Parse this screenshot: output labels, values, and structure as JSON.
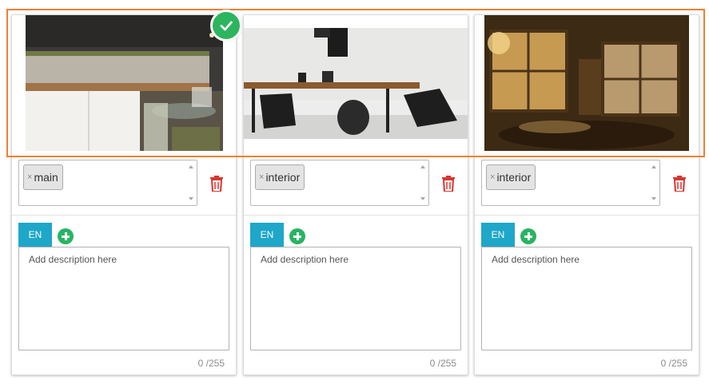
{
  "colors": {
    "selection_border": "#f07f32",
    "selected_badge": "#2cb55e",
    "lang_tab": "#1ea7c9",
    "add_button": "#27b563",
    "delete_icon": "#d9362f"
  },
  "cards": [
    {
      "image": "kitchen-photo",
      "selected": true,
      "tags": [
        "main"
      ],
      "language_tab": "EN",
      "description_placeholder": "Add description here",
      "description_value": "",
      "char_counter": "0 /255"
    },
    {
      "image": "dining-room-photo",
      "selected": false,
      "tags": [
        "interior"
      ],
      "language_tab": "EN",
      "description_placeholder": "Add description here",
      "description_value": "",
      "char_counter": "0 /255"
    },
    {
      "image": "living-room-sunset-photo",
      "selected": false,
      "tags": [
        "interior"
      ],
      "language_tab": "EN",
      "description_placeholder": "Add description here",
      "description_value": "",
      "char_counter": "0 /255"
    }
  ],
  "icons": {
    "tag_remove": "×",
    "delete": "trash-icon",
    "add_language": "plus-circle-icon",
    "selected": "check-icon"
  }
}
